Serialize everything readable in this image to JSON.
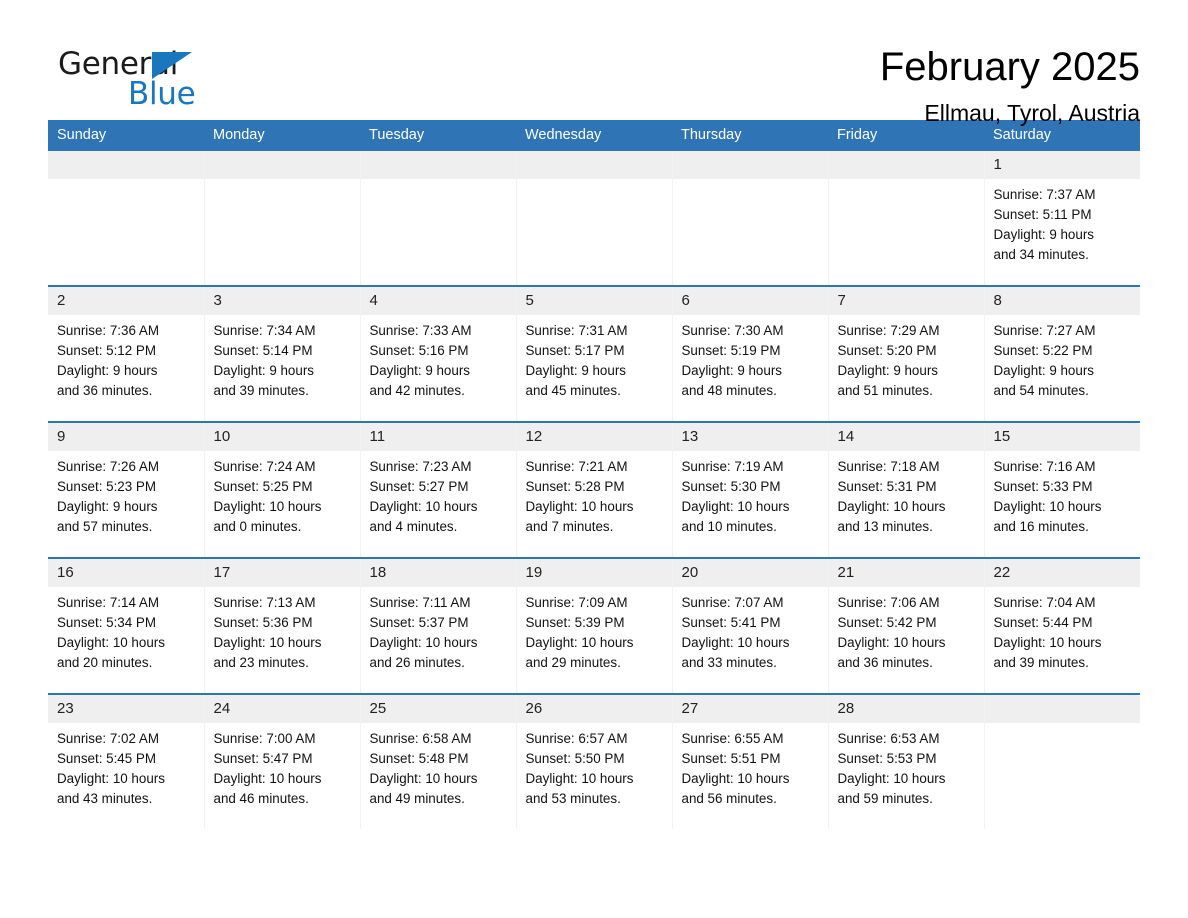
{
  "brand": {
    "name_part1": "General",
    "name_part2": "Blue",
    "accent_color": "#1877bd"
  },
  "header": {
    "title": "February 2025",
    "subtitle": "Ellmau, Tyrol, Austria",
    "header_bg_color": "#2f74b5",
    "daynum_bg_color": "#efefef"
  },
  "weekdays": [
    "Sunday",
    "Monday",
    "Tuesday",
    "Wednesday",
    "Thursday",
    "Friday",
    "Saturday"
  ],
  "weeks": [
    [
      {
        "day": "",
        "empty": true
      },
      {
        "day": "",
        "empty": true
      },
      {
        "day": "",
        "empty": true
      },
      {
        "day": "",
        "empty": true
      },
      {
        "day": "",
        "empty": true
      },
      {
        "day": "",
        "empty": true
      },
      {
        "day": "1",
        "sunrise": "Sunrise: 7:37 AM",
        "sunset": "Sunset: 5:11 PM",
        "daylight1": "Daylight: 9 hours",
        "daylight2": "and 34 minutes."
      }
    ],
    [
      {
        "day": "2",
        "sunrise": "Sunrise: 7:36 AM",
        "sunset": "Sunset: 5:12 PM",
        "daylight1": "Daylight: 9 hours",
        "daylight2": "and 36 minutes."
      },
      {
        "day": "3",
        "sunrise": "Sunrise: 7:34 AM",
        "sunset": "Sunset: 5:14 PM",
        "daylight1": "Daylight: 9 hours",
        "daylight2": "and 39 minutes."
      },
      {
        "day": "4",
        "sunrise": "Sunrise: 7:33 AM",
        "sunset": "Sunset: 5:16 PM",
        "daylight1": "Daylight: 9 hours",
        "daylight2": "and 42 minutes."
      },
      {
        "day": "5",
        "sunrise": "Sunrise: 7:31 AM",
        "sunset": "Sunset: 5:17 PM",
        "daylight1": "Daylight: 9 hours",
        "daylight2": "and 45 minutes."
      },
      {
        "day": "6",
        "sunrise": "Sunrise: 7:30 AM",
        "sunset": "Sunset: 5:19 PM",
        "daylight1": "Daylight: 9 hours",
        "daylight2": "and 48 minutes."
      },
      {
        "day": "7",
        "sunrise": "Sunrise: 7:29 AM",
        "sunset": "Sunset: 5:20 PM",
        "daylight1": "Daylight: 9 hours",
        "daylight2": "and 51 minutes."
      },
      {
        "day": "8",
        "sunrise": "Sunrise: 7:27 AM",
        "sunset": "Sunset: 5:22 PM",
        "daylight1": "Daylight: 9 hours",
        "daylight2": "and 54 minutes."
      }
    ],
    [
      {
        "day": "9",
        "sunrise": "Sunrise: 7:26 AM",
        "sunset": "Sunset: 5:23 PM",
        "daylight1": "Daylight: 9 hours",
        "daylight2": "and 57 minutes."
      },
      {
        "day": "10",
        "sunrise": "Sunrise: 7:24 AM",
        "sunset": "Sunset: 5:25 PM",
        "daylight1": "Daylight: 10 hours",
        "daylight2": "and 0 minutes."
      },
      {
        "day": "11",
        "sunrise": "Sunrise: 7:23 AM",
        "sunset": "Sunset: 5:27 PM",
        "daylight1": "Daylight: 10 hours",
        "daylight2": "and 4 minutes."
      },
      {
        "day": "12",
        "sunrise": "Sunrise: 7:21 AM",
        "sunset": "Sunset: 5:28 PM",
        "daylight1": "Daylight: 10 hours",
        "daylight2": "and 7 minutes."
      },
      {
        "day": "13",
        "sunrise": "Sunrise: 7:19 AM",
        "sunset": "Sunset: 5:30 PM",
        "daylight1": "Daylight: 10 hours",
        "daylight2": "and 10 minutes."
      },
      {
        "day": "14",
        "sunrise": "Sunrise: 7:18 AM",
        "sunset": "Sunset: 5:31 PM",
        "daylight1": "Daylight: 10 hours",
        "daylight2": "and 13 minutes."
      },
      {
        "day": "15",
        "sunrise": "Sunrise: 7:16 AM",
        "sunset": "Sunset: 5:33 PM",
        "daylight1": "Daylight: 10 hours",
        "daylight2": "and 16 minutes."
      }
    ],
    [
      {
        "day": "16",
        "sunrise": "Sunrise: 7:14 AM",
        "sunset": "Sunset: 5:34 PM",
        "daylight1": "Daylight: 10 hours",
        "daylight2": "and 20 minutes."
      },
      {
        "day": "17",
        "sunrise": "Sunrise: 7:13 AM",
        "sunset": "Sunset: 5:36 PM",
        "daylight1": "Daylight: 10 hours",
        "daylight2": "and 23 minutes."
      },
      {
        "day": "18",
        "sunrise": "Sunrise: 7:11 AM",
        "sunset": "Sunset: 5:37 PM",
        "daylight1": "Daylight: 10 hours",
        "daylight2": "and 26 minutes."
      },
      {
        "day": "19",
        "sunrise": "Sunrise: 7:09 AM",
        "sunset": "Sunset: 5:39 PM",
        "daylight1": "Daylight: 10 hours",
        "daylight2": "and 29 minutes."
      },
      {
        "day": "20",
        "sunrise": "Sunrise: 7:07 AM",
        "sunset": "Sunset: 5:41 PM",
        "daylight1": "Daylight: 10 hours",
        "daylight2": "and 33 minutes."
      },
      {
        "day": "21",
        "sunrise": "Sunrise: 7:06 AM",
        "sunset": "Sunset: 5:42 PM",
        "daylight1": "Daylight: 10 hours",
        "daylight2": "and 36 minutes."
      },
      {
        "day": "22",
        "sunrise": "Sunrise: 7:04 AM",
        "sunset": "Sunset: 5:44 PM",
        "daylight1": "Daylight: 10 hours",
        "daylight2": "and 39 minutes."
      }
    ],
    [
      {
        "day": "23",
        "sunrise": "Sunrise: 7:02 AM",
        "sunset": "Sunset: 5:45 PM",
        "daylight1": "Daylight: 10 hours",
        "daylight2": "and 43 minutes."
      },
      {
        "day": "24",
        "sunrise": "Sunrise: 7:00 AM",
        "sunset": "Sunset: 5:47 PM",
        "daylight1": "Daylight: 10 hours",
        "daylight2": "and 46 minutes."
      },
      {
        "day": "25",
        "sunrise": "Sunrise: 6:58 AM",
        "sunset": "Sunset: 5:48 PM",
        "daylight1": "Daylight: 10 hours",
        "daylight2": "and 49 minutes."
      },
      {
        "day": "26",
        "sunrise": "Sunrise: 6:57 AM",
        "sunset": "Sunset: 5:50 PM",
        "daylight1": "Daylight: 10 hours",
        "daylight2": "and 53 minutes."
      },
      {
        "day": "27",
        "sunrise": "Sunrise: 6:55 AM",
        "sunset": "Sunset: 5:51 PM",
        "daylight1": "Daylight: 10 hours",
        "daylight2": "and 56 minutes."
      },
      {
        "day": "28",
        "sunrise": "Sunrise: 6:53 AM",
        "sunset": "Sunset: 5:53 PM",
        "daylight1": "Daylight: 10 hours",
        "daylight2": "and 59 minutes."
      },
      {
        "day": "",
        "empty": true
      }
    ]
  ]
}
